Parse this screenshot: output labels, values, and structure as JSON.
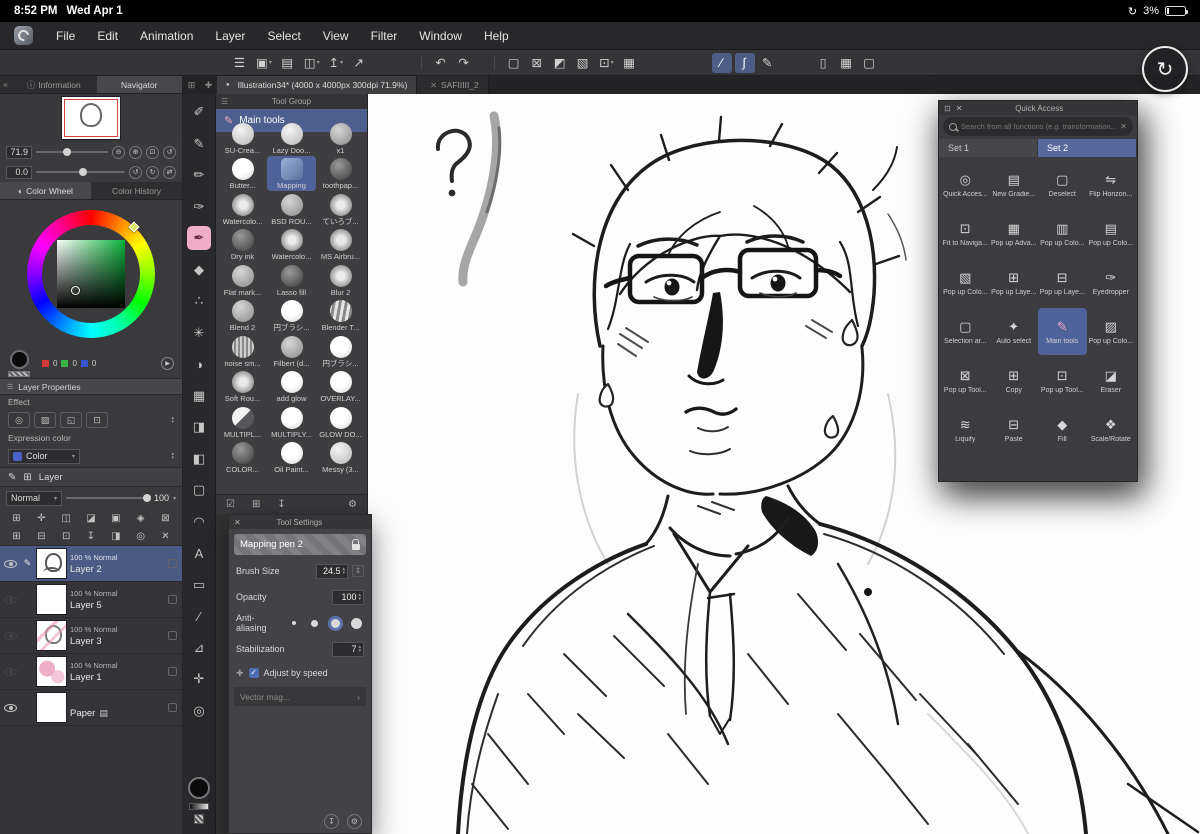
{
  "status_bar": {
    "time": "8:52 PM",
    "date": "Wed Apr 1",
    "battery": "3%"
  },
  "menu_bar": {
    "items": [
      "File",
      "Edit",
      "Animation",
      "Layer",
      "Select",
      "View",
      "Filter",
      "Window",
      "Help"
    ]
  },
  "glyphs": {
    "menu": "☰",
    "close": "✕",
    "caret_down": "▾",
    "caret_up": "▴",
    "chevron_left": "«",
    "chevron_right": "›",
    "play": "▶",
    "minus_circle": "⊖",
    "plus_circle": "⊕",
    "fit": "⊡",
    "rotate_ccw": "↺",
    "rotate_cw": "↻",
    "swap": "⇄",
    "info": "ⓘ",
    "pen": "✎",
    "stack": "⊞",
    "plus": "✚",
    "gear": "⚙",
    "download": "↧",
    "check": "✓",
    "dot": "●",
    "half_circle": "◐",
    "sync": "↻"
  },
  "toolbar": {
    "group1": [
      {
        "name": "main-menu",
        "glyph": "☰"
      },
      {
        "name": "new-canvas",
        "glyph": "▣",
        "caret": "▾"
      },
      {
        "name": "open-file",
        "glyph": "▤"
      },
      {
        "name": "save",
        "glyph": "◫",
        "caret": "▾"
      },
      {
        "name": "export",
        "glyph": "↥",
        "caret": "▾"
      },
      {
        "name": "share",
        "glyph": "↗"
      }
    ],
    "group2": [
      {
        "name": "undo",
        "glyph": "↶"
      },
      {
        "name": "redo",
        "glyph": "↷"
      }
    ],
    "group3": [
      {
        "name": "select-area",
        "glyph": "▢"
      },
      {
        "name": "deselect",
        "glyph": "⊠"
      },
      {
        "name": "invert-selection",
        "glyph": "◩"
      },
      {
        "name": "expand-selection",
        "glyph": "▧"
      },
      {
        "name": "transform",
        "glyph": "⊡",
        "caret": "▾"
      },
      {
        "name": "mesh-transform",
        "glyph": "▦"
      }
    ],
    "group4": [
      {
        "name": "snap-to-ruler",
        "glyph": "∕",
        "state": "active"
      },
      {
        "name": "snap-to-curve",
        "glyph": "∫",
        "state": "active"
      },
      {
        "name": "line-correction",
        "glyph": "✎"
      }
    ],
    "group5": [
      {
        "name": "companion-device",
        "glyph": "▯"
      },
      {
        "name": "workspace-layout",
        "glyph": "▦"
      },
      {
        "name": "more-options",
        "glyph": "▢"
      }
    ]
  },
  "doc_tabs": {
    "tabs": [
      {
        "dot": "●",
        "label": "Illustration34* (4000 x 4000px 300dpi 71.9%)",
        "state": "active"
      },
      {
        "close": "✕",
        "label": "SAFIIIII_2"
      }
    ]
  },
  "navigator": {
    "tabs": [
      {
        "label": "Information"
      },
      {
        "label": "Navigator",
        "state": "active"
      }
    ],
    "zoom_value": "71.9",
    "rotation_value": "0.0"
  },
  "color_panel": {
    "tabs": [
      {
        "label": "Color Wheel",
        "state": "active"
      },
      {
        "label": "Color History"
      }
    ],
    "rgb": [
      {
        "color": "#d23a3a",
        "value": "0"
      },
      {
        "color": "#3ab54a",
        "value": "0"
      },
      {
        "color": "#3a55d2",
        "value": "0"
      }
    ]
  },
  "layer_properties": {
    "title": "Layer Properties",
    "effect_label": "Effect",
    "effect_icons": [
      {
        "name": "border-effect-icon",
        "glyph": "◎"
      },
      {
        "name": "tone-effect-icon",
        "glyph": "▨"
      },
      {
        "name": "layer-color-effect-icon",
        "glyph": "◱"
      },
      {
        "name": "extract-line-effect-icon",
        "glyph": "⊡"
      }
    ],
    "expression_label": "Expression color",
    "expression_value": "Color",
    "expression_chip": "#4a62c8"
  },
  "layer_panel": {
    "tab_label": "Layer",
    "blend_mode": "Normal",
    "opacity": "100",
    "icon_row1": [
      {
        "name": "layer-grid-icon",
        "glyph": "⊞"
      },
      {
        "name": "clip-to-layer-icon",
        "glyph": "✛"
      },
      {
        "name": "lock-layer-icon",
        "glyph": "◫"
      },
      {
        "name": "lock-transparency-icon",
        "glyph": "◪"
      },
      {
        "name": "enable-mask-icon",
        "glyph": "▣"
      },
      {
        "name": "set-as-reference-icon",
        "glyph": "◈"
      },
      {
        "name": "draft-layer-icon",
        "glyph": "⊠"
      }
    ],
    "icon_row2": [
      {
        "name": "new-raster-layer-icon",
        "glyph": "⊞"
      },
      {
        "name": "new-folder-icon",
        "glyph": "⊟"
      },
      {
        "name": "duplicate-layer-icon",
        "glyph": "⊡"
      },
      {
        "name": "merge-down-icon",
        "glyph": "↧"
      },
      {
        "name": "layer-mask-icon",
        "glyph": "◨"
      },
      {
        "name": "layer-settings-icon",
        "glyph": "◎"
      },
      {
        "name": "delete-layer-icon",
        "glyph": "✕"
      }
    ],
    "layers": [
      {
        "eye": "on",
        "edit_glyph": "✎",
        "thumb": "th-sketch",
        "info": "100 %  Normal",
        "name": "Layer 2",
        "state": "selected",
        "badge": ""
      },
      {
        "eye": "off",
        "edit_glyph": "",
        "thumb": "th-plain",
        "info": "100 %  Normal",
        "name": "Layer 5",
        "badge": ""
      },
      {
        "eye": "off",
        "edit_glyph": "",
        "thumb": "th-pink-sketch",
        "info": "100 %  Normal",
        "name": "Layer 3",
        "badge": ""
      },
      {
        "eye": "off",
        "edit_glyph": "",
        "thumb": "th-pink",
        "info": "100 %  Normal",
        "name": "Layer 1",
        "badge": ""
      },
      {
        "eye": "on",
        "edit_glyph": "",
        "thumb": "th-plain",
        "info": "",
        "name": "Paper",
        "badge": "▤"
      }
    ]
  },
  "tool_strip": {
    "items": [
      {
        "name": "pen-tool",
        "glyph": "✐"
      },
      {
        "name": "calligraphy-tool",
        "glyph": "✎"
      },
      {
        "name": "pencil-tool",
        "glyph": "✏"
      },
      {
        "name": "brush-tool",
        "glyph": "✑"
      },
      {
        "name": "marker-tool",
        "glyph": "✒",
        "state": "selected"
      },
      {
        "name": "ink-tool",
        "glyph": "◆"
      },
      {
        "name": "airbrush-tool",
        "glyph": "∴"
      },
      {
        "name": "decoration-tool",
        "glyph": "✳"
      },
      {
        "name": "blend-tool",
        "glyph": "◑"
      },
      {
        "name": "frame-border-tool",
        "glyph": "▦"
      },
      {
        "name": "eraser-tool",
        "glyph": "◨"
      },
      {
        "name": "soft-eraser-tool",
        "glyph": "◧"
      },
      {
        "name": "selection-tool",
        "glyph": "▢"
      },
      {
        "name": "lasso-tool",
        "glyph": "◠"
      },
      {
        "name": "text-tool",
        "glyph": "A"
      },
      {
        "name": "balloon-tool",
        "glyph": "▭"
      },
      {
        "name": "line-tool",
        "glyph": "∕"
      },
      {
        "name": "ruler-tool",
        "glyph": "⊿"
      },
      {
        "name": "hand-tool",
        "glyph": "✛"
      },
      {
        "name": "eyedropper-tool",
        "glyph": "◎"
      }
    ]
  },
  "tool_group": {
    "title": "Tool Group",
    "group_name": "Main tools",
    "tools": [
      {
        "label": "SU-Crea...",
        "swatch": "sw-light"
      },
      {
        "label": "Lazy Doo...",
        "swatch": "sw-light"
      },
      {
        "label": "x1",
        "swatch": "sw-mid"
      },
      {
        "label": "Butter...",
        "swatch": "sw-white"
      },
      {
        "label": "Mapping",
        "swatch": "sw-map",
        "state": "selected"
      },
      {
        "label": "toothpap...",
        "swatch": "sw-dark"
      },
      {
        "label": "Watercolo...",
        "swatch": "sw-soft"
      },
      {
        "label": "BSD ROU...",
        "swatch": "sw-mid"
      },
      {
        "label": "ていろブ...",
        "swatch": "sw-soft"
      },
      {
        "label": "Dry ink",
        "swatch": "sw-dark"
      },
      {
        "label": "Watercolo...",
        "swatch": "sw-soft"
      },
      {
        "label": "MS Airbru...",
        "swatch": "sw-soft"
      },
      {
        "label": "Flat mark...",
        "swatch": "sw-mid"
      },
      {
        "label": "Lasso fill",
        "swatch": "sw-dark"
      },
      {
        "label": "Blur 2",
        "swatch": "sw-soft"
      },
      {
        "label": "Blend 2",
        "swatch": "sw-mid"
      },
      {
        "label": "円ブラシ...",
        "swatch": "sw-white"
      },
      {
        "label": "Blender T...",
        "swatch": "sw-streak"
      },
      {
        "label": "noise sm...",
        "swatch": "sw-noise"
      },
      {
        "label": "Filbert (d...",
        "swatch": "sw-mid"
      },
      {
        "label": "円ブラシ...",
        "swatch": "sw-white"
      },
      {
        "label": "Soft Rou...",
        "swatch": "sw-soft"
      },
      {
        "label": "add glow",
        "swatch": "sw-white"
      },
      {
        "label": "OVERLAY...",
        "swatch": "sw-white"
      },
      {
        "label": "MULTIPL...",
        "swatch": "sw-half"
      },
      {
        "label": "MULTIPLY...",
        "swatch": "sw-white"
      },
      {
        "label": "GLOW DO...",
        "swatch": "sw-white"
      },
      {
        "label": "COLOR...",
        "swatch": "sw-dark"
      },
      {
        "label": "Oil Paint...",
        "swatch": "sw-white"
      },
      {
        "label": "Messy (3...",
        "swatch": "sw-light"
      }
    ],
    "footer_icons": [
      {
        "name": "multi-select-icon",
        "glyph": "☑"
      },
      {
        "name": "add-tool-icon",
        "glyph": "⊞"
      },
      {
        "name": "import-tool-icon",
        "glyph": "↧"
      },
      {
        "name": "tool-menu-icon",
        "glyph": "⚙"
      }
    ]
  },
  "tool_settings": {
    "title": "Tool Settings",
    "tool_name": "Mapping pen 2",
    "brush_size_label": "Brush Size",
    "brush_size_value": "24.5",
    "opacity_label": "Opacity",
    "opacity_value": "100",
    "anti_aliasing_label": "Anti-aliasing",
    "stabilization_label": "Stabilization",
    "stabilization_value": "7",
    "adjust_by_speed_label": "Adjust by speed",
    "vector_label": "Vector mag..."
  },
  "quick_access": {
    "title": "Quick Access",
    "search_placeholder": "Search from all functions (e.g. transformation...)",
    "tabs": [
      {
        "label": "Set 1"
      },
      {
        "label": "Set 2",
        "state": "selected"
      }
    ],
    "items": [
      {
        "name": "quick-access",
        "label": "Quick Acces...",
        "glyph": "◎"
      },
      {
        "name": "new-gradient",
        "label": "New Gradie...",
        "glyph": "▤"
      },
      {
        "name": "deselect",
        "label": "Deselect",
        "glyph": "▢"
      },
      {
        "name": "flip-horizontal",
        "label": "Flip Horizon...",
        "glyph": "⇋"
      },
      {
        "name": "fit-to-navigator",
        "label": "Fit to Naviga...",
        "glyph": "⊡"
      },
      {
        "name": "popup-advanced",
        "label": "Pop up Adva...",
        "glyph": "▦"
      },
      {
        "name": "popup-color-1",
        "label": "Pop up Colo...",
        "glyph": "▥"
      },
      {
        "name": "popup-color-2",
        "label": "Pop up Colo...",
        "glyph": "▤"
      },
      {
        "name": "popup-color-3",
        "label": "Pop up Colo...",
        "glyph": "▧"
      },
      {
        "name": "popup-layer-1",
        "label": "Pop up Laye...",
        "glyph": "⊞"
      },
      {
        "name": "popup-layer-2",
        "label": "Pop up Laye...",
        "glyph": "⊟"
      },
      {
        "name": "eyedropper",
        "label": "Eyedropper",
        "glyph": "✑"
      },
      {
        "name": "selection-area",
        "label": "Selection ar...",
        "glyph": "▢"
      },
      {
        "name": "auto-select",
        "label": "Auto select",
        "glyph": "✦"
      },
      {
        "name": "main-tools",
        "label": "Main tools",
        "glyph": "✎",
        "state": "selected",
        "icon_class": "pink"
      },
      {
        "name": "popup-color-4",
        "label": "Pop up Colo...",
        "glyph": "▨"
      },
      {
        "name": "popup-tool-1",
        "label": "Pop up Tool...",
        "glyph": "⊠"
      },
      {
        "name": "copy",
        "label": "Copy",
        "glyph": "⊞"
      },
      {
        "name": "popup-tool-2",
        "label": "Pop up Tool...",
        "glyph": "⊡"
      },
      {
        "name": "eraser",
        "label": "Eraser",
        "glyph": "◪"
      },
      {
        "name": "liquify",
        "label": "Liquify",
        "glyph": "≋"
      },
      {
        "name": "paste",
        "label": "Paste",
        "glyph": "⊟"
      },
      {
        "name": "fill",
        "label": "Fill",
        "glyph": "◆"
      },
      {
        "name": "scale-rotate",
        "label": "Scale/Rotate",
        "glyph": "❖"
      }
    ]
  },
  "colors": {
    "accent_blue": "#50629a",
    "accent_pink": "#f0aec6",
    "selection_blue": "#4a5a82"
  }
}
